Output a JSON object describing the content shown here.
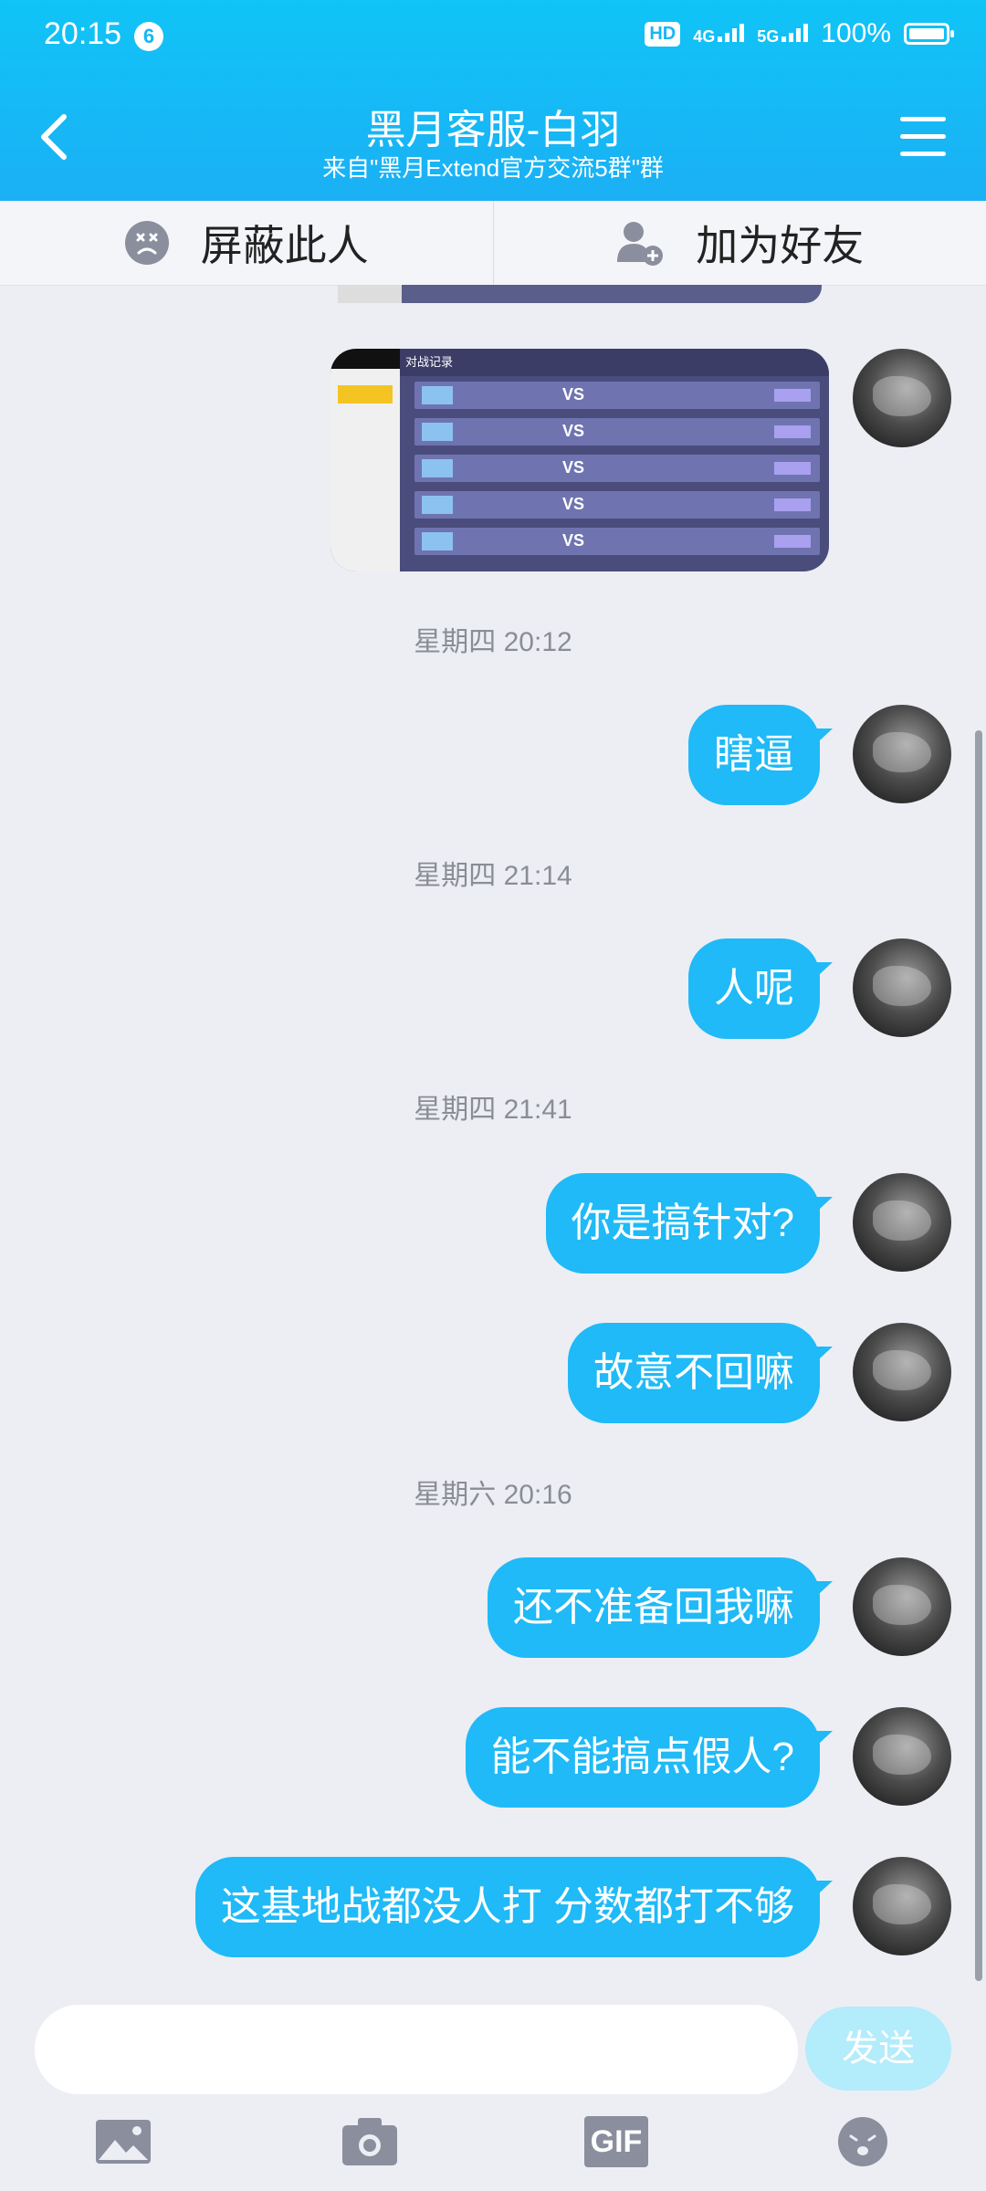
{
  "status_bar": {
    "time": "20:15",
    "notification_count": "6",
    "hd_label": "HD",
    "net1": "4G",
    "net2": "5G",
    "battery": "100%"
  },
  "header": {
    "title": "黑月客服-白羽",
    "subtitle": "来自\"黑月Extend官方交流5群\"群"
  },
  "actions": {
    "block_label": "屏蔽此人",
    "add_friend_label": "加为好友"
  },
  "image_message": {
    "header_text": "对战记录",
    "vs_label": "VS"
  },
  "timestamps": [
    "星期四  20:12",
    "星期四  21:14",
    "星期四  21:41",
    "星期六  20:16"
  ],
  "messages": [
    {
      "text": "瞎逼"
    },
    {
      "text": "人呢"
    },
    {
      "text": "你是搞针对?"
    },
    {
      "text": "故意不回嘛"
    },
    {
      "text": "还不准备回我嘛"
    },
    {
      "text": "能不能搞点假人?"
    },
    {
      "text": "这基地战都没人打  分数都打不够"
    }
  ],
  "input": {
    "placeholder": "",
    "send_label": "发送",
    "gif_label": "GIF"
  },
  "colors": {
    "header": "#16b7f5",
    "bubble": "#1fbaf7",
    "send_disabled": "#b3ecfb",
    "background": "#eceef4"
  }
}
